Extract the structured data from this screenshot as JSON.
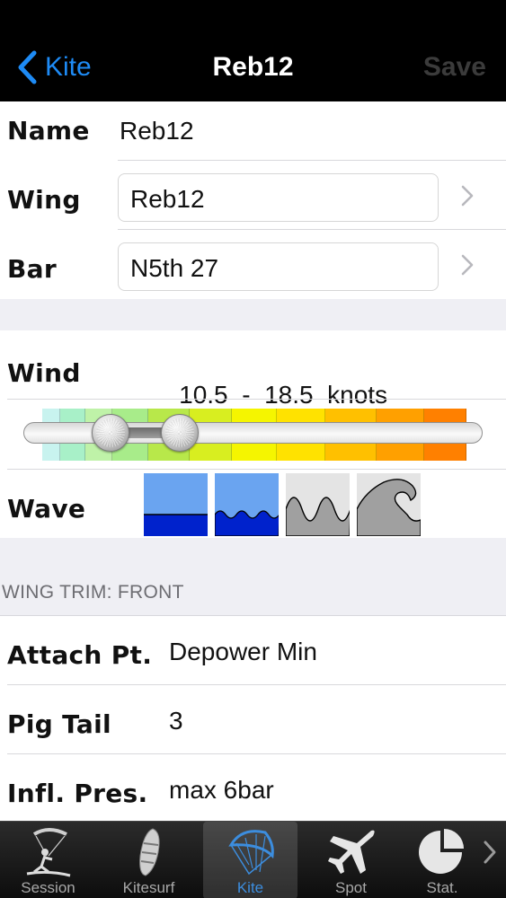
{
  "nav": {
    "back_label": "Kite",
    "title": "Reb12",
    "save_label": "Save"
  },
  "form": {
    "name": {
      "label": "Name",
      "value": "Reb12"
    },
    "wing": {
      "label": "Wing",
      "value": "Reb12"
    },
    "bar": {
      "label": "Bar",
      "value": "N5th 27"
    }
  },
  "wind": {
    "label": "Wind",
    "min": "10.5",
    "separator": "-",
    "max": "18.5",
    "unit": "knots",
    "scale_colors": [
      "#c8f3ef",
      "#a8f0c8",
      "#bff2a8",
      "#a8ec8a",
      "#b8e84a",
      "#d8ee20",
      "#f5f500",
      "#ffe200",
      "#ffc000",
      "#ffa000",
      "#ff8000"
    ],
    "low_fraction": 0.19,
    "high_fraction": 0.34
  },
  "wave": {
    "label": "Wave",
    "options": [
      "flat-wave-icon",
      "small-wave-icon",
      "medium-wave-icon",
      "big-wave-icon"
    ],
    "selected": [
      0,
      1
    ]
  },
  "trim": {
    "header": "WING TRIM: FRONT",
    "rows": [
      {
        "label": "Attach Pt.",
        "value": "Depower Min"
      },
      {
        "label": "Pig Tail",
        "value": "3"
      },
      {
        "label": "Infl. Pres.",
        "value": "max 6bar"
      }
    ]
  },
  "tabs": [
    {
      "label": "Session",
      "icon": "kiter-session-icon",
      "selected": false
    },
    {
      "label": "Kitesurf",
      "icon": "kitesurf-board-icon",
      "selected": false
    },
    {
      "label": "Kite",
      "icon": "kite-icon",
      "selected": true
    },
    {
      "label": "Spot",
      "icon": "airplane-icon",
      "selected": false
    },
    {
      "label": "Stat.",
      "icon": "pie-chart-icon",
      "selected": false
    }
  ],
  "colors": {
    "accent": "#1e8bf5",
    "tab_selected": "#3c8dde",
    "wave_selected": "#0022cc",
    "wave_unselected": "#a0a0a0"
  }
}
